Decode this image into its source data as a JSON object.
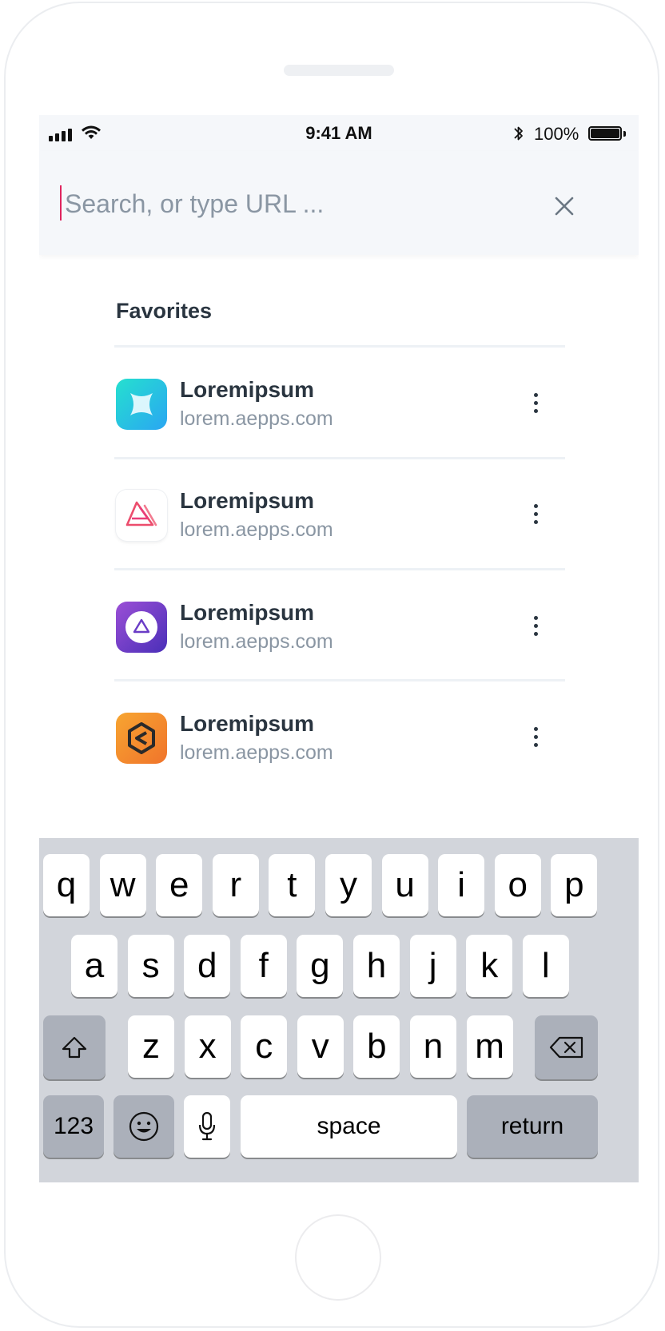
{
  "status_bar": {
    "time": "9:41 AM",
    "battery": "100%"
  },
  "search": {
    "placeholder": "Search, or type URL ...",
    "value": ""
  },
  "favorites": {
    "title": "Favorites",
    "items": [
      {
        "name": "Loremipsum",
        "url": "lorem.aepps.com",
        "icon": "blue-x-app-icon"
      },
      {
        "name": "Loremipsum",
        "url": "lorem.aepps.com",
        "icon": "pink-triangle-app-icon"
      },
      {
        "name": "Loremipsum",
        "url": "lorem.aepps.com",
        "icon": "purple-triangle-app-icon"
      },
      {
        "name": "Loremipsum",
        "url": "lorem.aepps.com",
        "icon": "orange-hexagon-app-icon"
      }
    ]
  },
  "keyboard": {
    "row1": [
      "q",
      "w",
      "e",
      "r",
      "t",
      "y",
      "u",
      "i",
      "o",
      "p"
    ],
    "row2": [
      "a",
      "s",
      "d",
      "f",
      "g",
      "h",
      "j",
      "k",
      "l"
    ],
    "row3": [
      "z",
      "x",
      "c",
      "v",
      "b",
      "n",
      "m"
    ],
    "numbers_label": "123",
    "space_label": "space",
    "return_label": "return"
  },
  "colors": {
    "accent_cursor": "#e0245e",
    "text_primary": "#2a3540",
    "text_secondary": "#8a96a3",
    "keyboard_bg": "#d2d5db"
  }
}
